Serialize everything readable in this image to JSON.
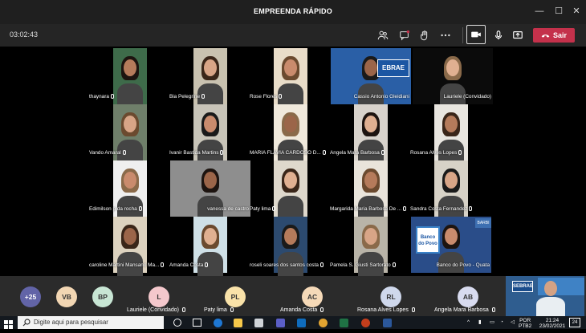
{
  "window": {
    "title": "EMPREENDA RÁPIDO",
    "minimize": "—",
    "maximize": "☐",
    "close": "✕"
  },
  "toolbar": {
    "timer": "03:02:43",
    "leave_label": "Sair"
  },
  "tiles": [
    {
      "name": "thaynara"
    },
    {
      "name": "Bia Pelegrine"
    },
    {
      "name": "Rose Flores"
    },
    {
      "name": "Cassio Antonio Gleidiani",
      "logo": "EBRAE"
    },
    {
      "name": "Lauriele (Convidado)"
    },
    {
      "name": "Vando Amaral"
    },
    {
      "name": "Ivanir Bastida Martins"
    },
    {
      "name": "MARIA FLAVIA CARDOSO D..."
    },
    {
      "name": "Angela Mara Barbosa"
    },
    {
      "name": "Rosana Alves Lopes"
    },
    {
      "name": "Edimilson p da rocha"
    },
    {
      "name": "vanessa de castro"
    },
    {
      "name": "Paty lima"
    },
    {
      "name": "Margarida Maria Barbosa De ..."
    },
    {
      "name": "Sandra Costa Fernandez"
    },
    {
      "name": "caroline Martini Mansano Ma..."
    },
    {
      "name": "Amanda Costa"
    },
    {
      "name": "roseli soares dos santos costa"
    },
    {
      "name": "Pamela S. Giusti Sartorato"
    },
    {
      "name": "Banco do Povo - Quata",
      "logo": "Banco do Povo",
      "logo2": "BARBI"
    }
  ],
  "roster": [
    {
      "initials": "+25",
      "color": "#6264a7"
    },
    {
      "initials": "VB",
      "color": "#f2d6b3"
    },
    {
      "initials": "BP",
      "color": "#c8e6d4"
    },
    {
      "initials": "L",
      "color": "#f4c8cc",
      "label": "Lauriele (Convidado)"
    },
    {
      "initials": "PL",
      "color": "#f9e2a9",
      "label": "Paty lima"
    },
    {
      "initials": "AC",
      "color": "#f5d9b8",
      "label": "Amanda Costa"
    },
    {
      "initials": "RL",
      "color": "#cfd8ec",
      "label": "Rosana Alves Lopes"
    },
    {
      "initials": "AB",
      "color": "#d8dbef",
      "label": "Angela Mara Barbosa"
    }
  ],
  "self_logo": "SEBRAE",
  "taskbar": {
    "search_placeholder": "Digite aqui para pesquisar",
    "lang": "POR",
    "lang2": "PTB2",
    "time": "21:24",
    "date": "23/02/2021",
    "notif": "24"
  }
}
